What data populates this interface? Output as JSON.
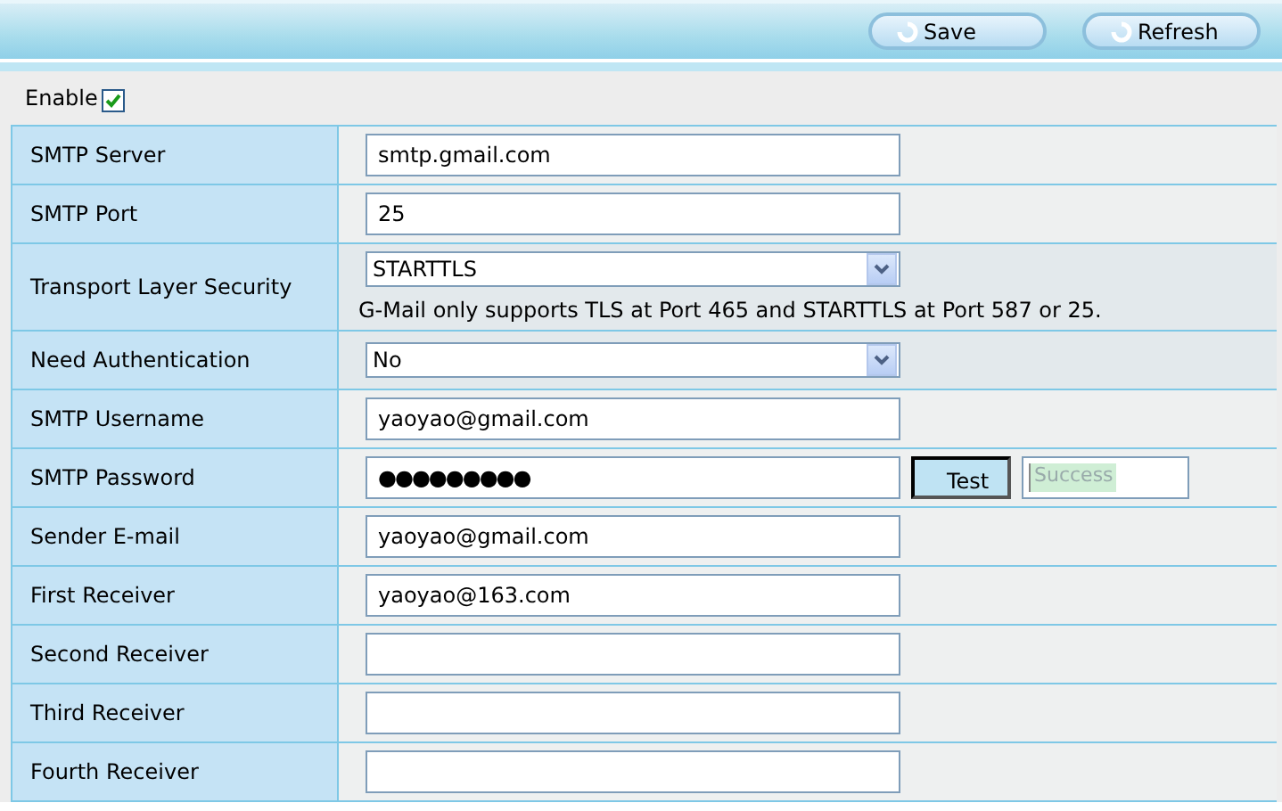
{
  "toolbar": {
    "buttons": [
      {
        "label": "Save"
      },
      {
        "label": "Refresh"
      }
    ]
  },
  "enable": {
    "label": "Enable",
    "checked": true
  },
  "rows": [
    {
      "kind": "text",
      "label": "SMTP Server",
      "value": "smtp.gmail.com"
    },
    {
      "kind": "text",
      "label": "SMTP Port",
      "value": "25"
    },
    {
      "kind": "select",
      "label": "Transport Layer Security",
      "value": "STARTTLS",
      "note": "G-Mail only supports TLS at Port 465 and STARTTLS at Port 587 or 25."
    },
    {
      "kind": "select",
      "label": "Need Authentication",
      "value": "No"
    },
    {
      "kind": "text",
      "label": "SMTP Username",
      "value": "yaoyao@gmail.com"
    },
    {
      "kind": "password",
      "label": "SMTP Password",
      "value": "●●●●●●●●●",
      "button": "Test",
      "result": "Success"
    },
    {
      "kind": "text",
      "label": "Sender E-mail",
      "value": "yaoyao@gmail.com"
    },
    {
      "kind": "text",
      "label": "First Receiver",
      "value": "yaoyao@163.com"
    },
    {
      "kind": "text",
      "label": "Second Receiver",
      "value": ""
    },
    {
      "kind": "text",
      "label": "Third Receiver",
      "value": ""
    },
    {
      "kind": "text",
      "label": "Fourth Receiver",
      "value": ""
    }
  ]
}
